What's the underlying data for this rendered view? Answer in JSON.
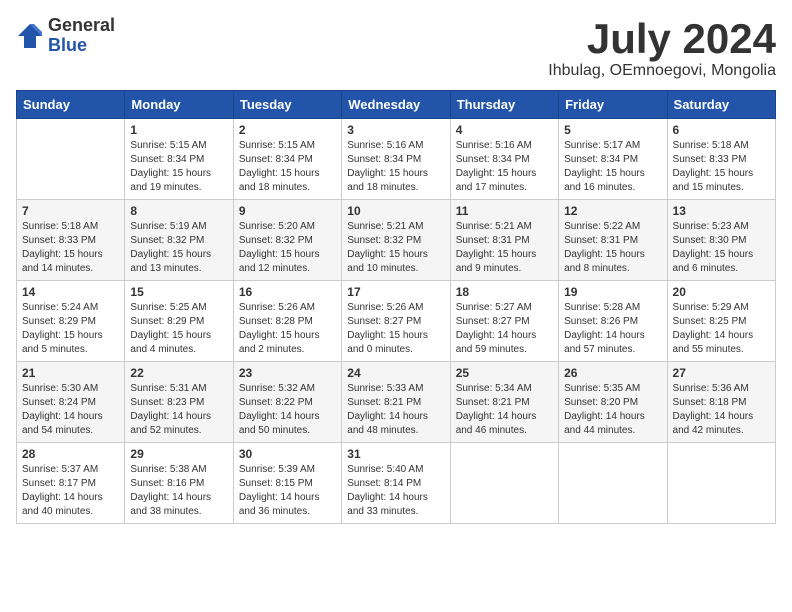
{
  "logo": {
    "general": "General",
    "blue": "Blue"
  },
  "title": {
    "month": "July 2024",
    "location": "Ihbulag, OEmnoegovi, Mongolia"
  },
  "weekdays": [
    "Sunday",
    "Monday",
    "Tuesday",
    "Wednesday",
    "Thursday",
    "Friday",
    "Saturday"
  ],
  "weeks": [
    [
      {
        "day": "",
        "info": ""
      },
      {
        "day": "1",
        "info": "Sunrise: 5:15 AM\nSunset: 8:34 PM\nDaylight: 15 hours\nand 19 minutes."
      },
      {
        "day": "2",
        "info": "Sunrise: 5:15 AM\nSunset: 8:34 PM\nDaylight: 15 hours\nand 18 minutes."
      },
      {
        "day": "3",
        "info": "Sunrise: 5:16 AM\nSunset: 8:34 PM\nDaylight: 15 hours\nand 18 minutes."
      },
      {
        "day": "4",
        "info": "Sunrise: 5:16 AM\nSunset: 8:34 PM\nDaylight: 15 hours\nand 17 minutes."
      },
      {
        "day": "5",
        "info": "Sunrise: 5:17 AM\nSunset: 8:34 PM\nDaylight: 15 hours\nand 16 minutes."
      },
      {
        "day": "6",
        "info": "Sunrise: 5:18 AM\nSunset: 8:33 PM\nDaylight: 15 hours\nand 15 minutes."
      }
    ],
    [
      {
        "day": "7",
        "info": "Sunrise: 5:18 AM\nSunset: 8:33 PM\nDaylight: 15 hours\nand 14 minutes."
      },
      {
        "day": "8",
        "info": "Sunrise: 5:19 AM\nSunset: 8:32 PM\nDaylight: 15 hours\nand 13 minutes."
      },
      {
        "day": "9",
        "info": "Sunrise: 5:20 AM\nSunset: 8:32 PM\nDaylight: 15 hours\nand 12 minutes."
      },
      {
        "day": "10",
        "info": "Sunrise: 5:21 AM\nSunset: 8:32 PM\nDaylight: 15 hours\nand 10 minutes."
      },
      {
        "day": "11",
        "info": "Sunrise: 5:21 AM\nSunset: 8:31 PM\nDaylight: 15 hours\nand 9 minutes."
      },
      {
        "day": "12",
        "info": "Sunrise: 5:22 AM\nSunset: 8:31 PM\nDaylight: 15 hours\nand 8 minutes."
      },
      {
        "day": "13",
        "info": "Sunrise: 5:23 AM\nSunset: 8:30 PM\nDaylight: 15 hours\nand 6 minutes."
      }
    ],
    [
      {
        "day": "14",
        "info": "Sunrise: 5:24 AM\nSunset: 8:29 PM\nDaylight: 15 hours\nand 5 minutes."
      },
      {
        "day": "15",
        "info": "Sunrise: 5:25 AM\nSunset: 8:29 PM\nDaylight: 15 hours\nand 4 minutes."
      },
      {
        "day": "16",
        "info": "Sunrise: 5:26 AM\nSunset: 8:28 PM\nDaylight: 15 hours\nand 2 minutes."
      },
      {
        "day": "17",
        "info": "Sunrise: 5:26 AM\nSunset: 8:27 PM\nDaylight: 15 hours\nand 0 minutes."
      },
      {
        "day": "18",
        "info": "Sunrise: 5:27 AM\nSunset: 8:27 PM\nDaylight: 14 hours\nand 59 minutes."
      },
      {
        "day": "19",
        "info": "Sunrise: 5:28 AM\nSunset: 8:26 PM\nDaylight: 14 hours\nand 57 minutes."
      },
      {
        "day": "20",
        "info": "Sunrise: 5:29 AM\nSunset: 8:25 PM\nDaylight: 14 hours\nand 55 minutes."
      }
    ],
    [
      {
        "day": "21",
        "info": "Sunrise: 5:30 AM\nSunset: 8:24 PM\nDaylight: 14 hours\nand 54 minutes."
      },
      {
        "day": "22",
        "info": "Sunrise: 5:31 AM\nSunset: 8:23 PM\nDaylight: 14 hours\nand 52 minutes."
      },
      {
        "day": "23",
        "info": "Sunrise: 5:32 AM\nSunset: 8:22 PM\nDaylight: 14 hours\nand 50 minutes."
      },
      {
        "day": "24",
        "info": "Sunrise: 5:33 AM\nSunset: 8:21 PM\nDaylight: 14 hours\nand 48 minutes."
      },
      {
        "day": "25",
        "info": "Sunrise: 5:34 AM\nSunset: 8:21 PM\nDaylight: 14 hours\nand 46 minutes."
      },
      {
        "day": "26",
        "info": "Sunrise: 5:35 AM\nSunset: 8:20 PM\nDaylight: 14 hours\nand 44 minutes."
      },
      {
        "day": "27",
        "info": "Sunrise: 5:36 AM\nSunset: 8:18 PM\nDaylight: 14 hours\nand 42 minutes."
      }
    ],
    [
      {
        "day": "28",
        "info": "Sunrise: 5:37 AM\nSunset: 8:17 PM\nDaylight: 14 hours\nand 40 minutes."
      },
      {
        "day": "29",
        "info": "Sunrise: 5:38 AM\nSunset: 8:16 PM\nDaylight: 14 hours\nand 38 minutes."
      },
      {
        "day": "30",
        "info": "Sunrise: 5:39 AM\nSunset: 8:15 PM\nDaylight: 14 hours\nand 36 minutes."
      },
      {
        "day": "31",
        "info": "Sunrise: 5:40 AM\nSunset: 8:14 PM\nDaylight: 14 hours\nand 33 minutes."
      },
      {
        "day": "",
        "info": ""
      },
      {
        "day": "",
        "info": ""
      },
      {
        "day": "",
        "info": ""
      }
    ]
  ]
}
